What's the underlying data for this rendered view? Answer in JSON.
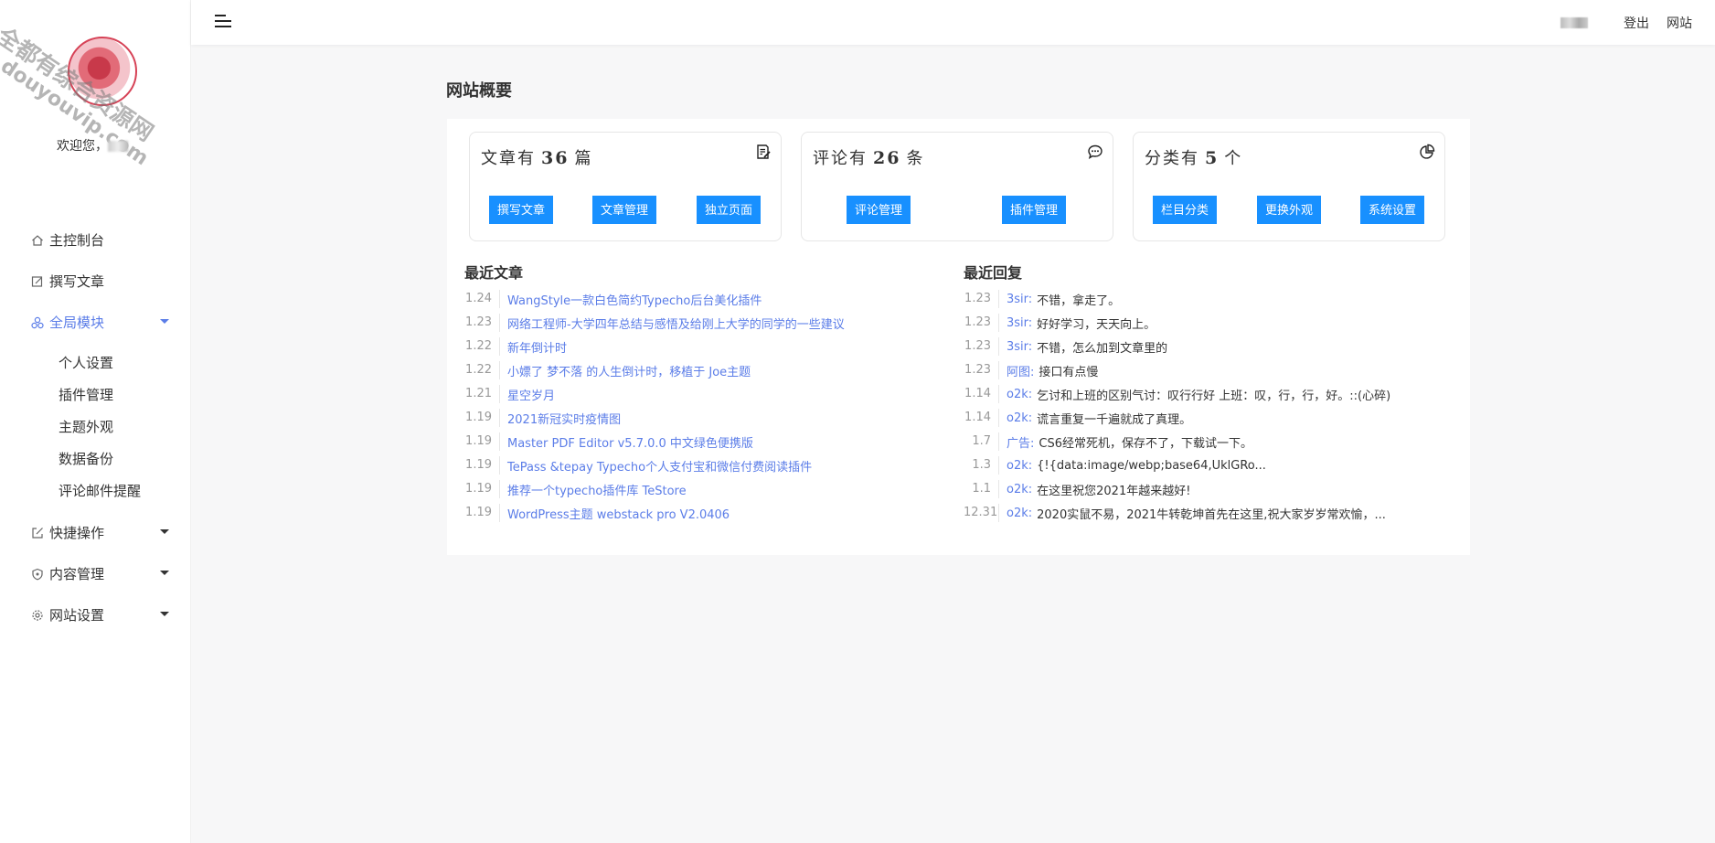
{
  "watermark": {
    "line1": "全都有综合资源网",
    "line2": "douyouvip.com"
  },
  "sidebar": {
    "welcome_prefix": "欢迎您，",
    "nav": [
      {
        "label": "主控制台",
        "icon": "home-icon"
      },
      {
        "label": "撰写文章",
        "icon": "edit-icon"
      },
      {
        "label": "全局模块",
        "icon": "modules-icon",
        "active": true
      },
      {
        "label": "快捷操作",
        "icon": "external-edit-icon"
      },
      {
        "label": "内容管理",
        "icon": "shield-icon"
      },
      {
        "label": "网站设置",
        "icon": "gear-icon"
      }
    ],
    "sub": [
      "个人设置",
      "插件管理",
      "主题外观",
      "数据备份",
      "评论邮件提醒"
    ]
  },
  "header": {
    "logout": "登出",
    "site": "网站"
  },
  "page_title": "网站概要",
  "cards": [
    {
      "prefix": "文章有",
      "count": "36",
      "suffix": "篇",
      "icon": "document-edit-icon",
      "buttons": [
        "撰写文章",
        "文章管理",
        "独立页面"
      ]
    },
    {
      "prefix": "评论有",
      "count": "26",
      "suffix": "条",
      "icon": "comment-icon",
      "buttons": [
        "评论管理",
        "插件管理"
      ]
    },
    {
      "prefix": "分类有",
      "count": "5",
      "suffix": "个",
      "icon": "pie-chart-icon",
      "buttons": [
        "栏目分类",
        "更换外观",
        "系统设置"
      ]
    }
  ],
  "recent_posts": {
    "title": "最近文章",
    "items": [
      {
        "date": "1.24",
        "title": "WangStyle一款白色简约Typecho后台美化插件"
      },
      {
        "date": "1.23",
        "title": "网络工程师-大学四年总结与感悟及给刚上大学的同学的一些建议"
      },
      {
        "date": "1.22",
        "title": "新年倒计时"
      },
      {
        "date": "1.22",
        "title": "小嫖了 梦不落 的人生倒计时，移植于 Joe主题"
      },
      {
        "date": "1.21",
        "title": "星空岁月"
      },
      {
        "date": "1.19",
        "title": "2021新冠实时疫情图"
      },
      {
        "date": "1.19",
        "title": "Master PDF Editor v5.7.0.0 中文绿色便携版"
      },
      {
        "date": "1.19",
        "title": "TePass &tepay Typecho个人支付宝和微信付费阅读插件"
      },
      {
        "date": "1.19",
        "title": "推荐一个typecho插件库 TeStore"
      },
      {
        "date": "1.19",
        "title": "WordPress主题 webstack pro V2.0406"
      }
    ]
  },
  "recent_replies": {
    "title": "最近回复",
    "items": [
      {
        "date": "1.23",
        "author": "3sir:",
        "text": "不错，拿走了。"
      },
      {
        "date": "1.23",
        "author": "3sir:",
        "text": "好好学习，天天向上。"
      },
      {
        "date": "1.23",
        "author": "3sir:",
        "text": "不错，怎么加到文章里的"
      },
      {
        "date": "1.23",
        "author": "阿图:",
        "text": "接口有点慢"
      },
      {
        "date": "1.14",
        "author": "o2k:",
        "text": "乞讨和上班的区别气讨：叹行行好 上班：叹，行，行，好。::(心碎)"
      },
      {
        "date": "1.14",
        "author": "o2k:",
        "text": "谎言重复一千遍就成了真理。"
      },
      {
        "date": "1.7",
        "author": "广告:",
        "text": "CS6经常死机，保存不了，下载试一下。"
      },
      {
        "date": "1.3",
        "author": "o2k:",
        "text": "{!{data:image/webp;base64,UklGRo..."
      },
      {
        "date": "1.1",
        "author": "o2k:",
        "text": "在这里祝您2021年越来越好!"
      },
      {
        "date": "12.31",
        "author": "o2k:",
        "text": "2020实鼠不易，2021牛转乾坤首先在这里,祝大家岁岁常欢愉，..."
      }
    ]
  }
}
